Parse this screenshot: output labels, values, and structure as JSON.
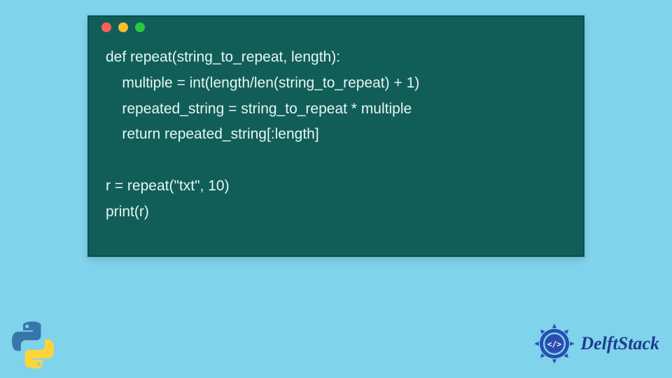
{
  "code": {
    "lines": [
      "def repeat(string_to_repeat, length):",
      "    multiple = int(length/len(string_to_repeat) + 1)",
      "    repeated_string = string_to_repeat * multiple",
      "    return repeated_string[:length]",
      "",
      "r = repeat(\"txt\", 10)",
      "print(r)"
    ]
  },
  "brand": {
    "name": "DelftStack"
  },
  "colors": {
    "page_bg": "#7fd3eb",
    "window_bg": "#115e59",
    "code_fg": "#e8f5f4",
    "brand_fg": "#1f3b8f"
  }
}
